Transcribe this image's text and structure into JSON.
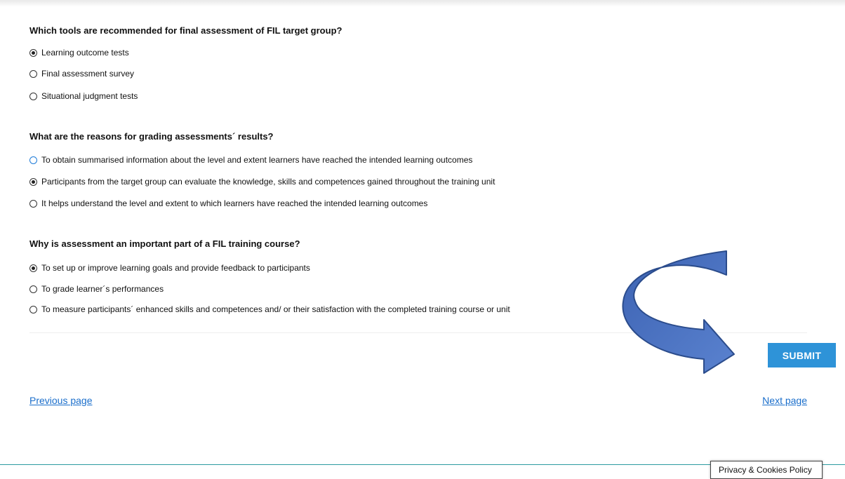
{
  "quiz": {
    "questions": [
      {
        "title": "Which tools are recommended for final assessment of FIL target group?",
        "options": [
          {
            "label": "Learning outcome tests",
            "checked": true
          },
          {
            "label": "Final assessment survey",
            "checked": false
          },
          {
            "label": "Situational judgment tests",
            "checked": false
          }
        ]
      },
      {
        "title": "What are the reasons for grading assessments´ results?",
        "options": [
          {
            "label": "To obtain summarised information about the level and extent learners have reached the intended learning outcomes",
            "checked": false
          },
          {
            "label": "Participants from the target group can evaluate the knowledge, skills and competences gained throughout the training unit",
            "checked": true
          },
          {
            "label": "It helps understand the level and extent to which learners have reached the intended learning outcomes",
            "checked": false
          }
        ]
      },
      {
        "title": "Why is assessment an important part of a FIL training course?",
        "options": [
          {
            "label": "To set up or improve learning goals and provide feedback to participants",
            "checked": true
          },
          {
            "label": "To grade learner´s performances",
            "checked": false
          },
          {
            "label": "To measure participants´ enhanced skills and competences and/ or their satisfaction with the completed training course or unit",
            "checked": false
          }
        ]
      }
    ],
    "submit_label": "SUBMIT"
  },
  "nav": {
    "previous_label": "Previous page",
    "next_label": "Next page"
  },
  "footer": {
    "privacy_label": "Privacy & Cookies Policy"
  },
  "colors": {
    "submit_bg": "#2e93d8",
    "link": "#1a6ecb",
    "arrow_fill": "#4a72c4",
    "arrow_stroke": "#2b4c8c"
  }
}
